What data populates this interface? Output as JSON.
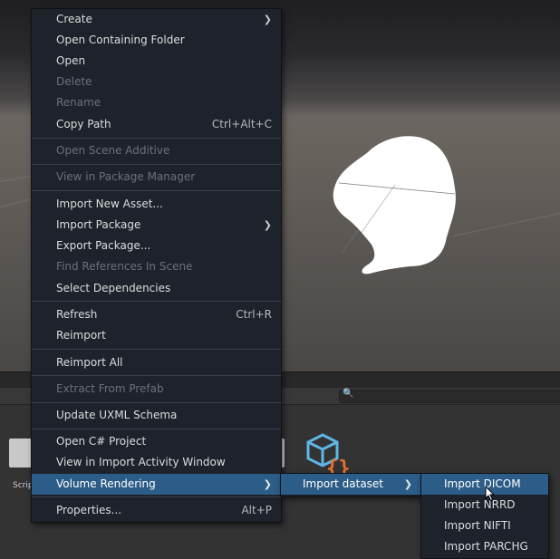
{
  "context_menu": {
    "items": [
      {
        "label": "Create",
        "submenu": true
      },
      {
        "label": "Open Containing Folder"
      },
      {
        "label": "Open"
      },
      {
        "label": "Delete",
        "disabled": true
      },
      {
        "label": "Rename",
        "disabled": true
      },
      {
        "label": "Copy Path",
        "shortcut": "Ctrl+Alt+C"
      },
      {
        "label": "Open Scene Additive",
        "disabled": true
      },
      {
        "label": "View in Package Manager",
        "disabled": true
      },
      {
        "label": "Import New Asset..."
      },
      {
        "label": "Import Package",
        "submenu": true
      },
      {
        "label": "Export Package..."
      },
      {
        "label": "Find References In Scene",
        "disabled": true
      },
      {
        "label": "Select Dependencies"
      },
      {
        "label": "Refresh",
        "shortcut": "Ctrl+R"
      },
      {
        "label": "Reimport"
      },
      {
        "label": "Reimport All"
      },
      {
        "label": "Extract From Prefab",
        "disabled": true
      },
      {
        "label": "Update UXML Schema"
      },
      {
        "label": "Open C# Project"
      },
      {
        "label": "View in Import Activity Window"
      },
      {
        "label": "Volume Rendering",
        "submenu": true,
        "highlighted": true
      },
      {
        "label": "Properties...",
        "shortcut": "Alt+P"
      }
    ]
  },
  "submenu_volume_rendering": {
    "items": [
      {
        "label": "Import dataset",
        "submenu": true
      }
    ]
  },
  "submenu_import_dataset": {
    "items": [
      {
        "label": "Import DICOM",
        "highlighted": true
      },
      {
        "label": "Import NRRD"
      },
      {
        "label": "Import NIFTI"
      },
      {
        "label": "Import PARCHG"
      }
    ]
  },
  "project_panel": {
    "folder_label": "Scrip"
  },
  "icons": {
    "submenu_arrow": "chevron-right-icon",
    "search": "search-icon",
    "cursor": "mouse-cursor-icon"
  },
  "colors": {
    "menu_background": "#1e232b",
    "highlight": "#2c5d88",
    "disabled_text": "#6b7079",
    "script_icon_orange": "#e8702a",
    "script_icon_blue": "#5fb6e6"
  }
}
